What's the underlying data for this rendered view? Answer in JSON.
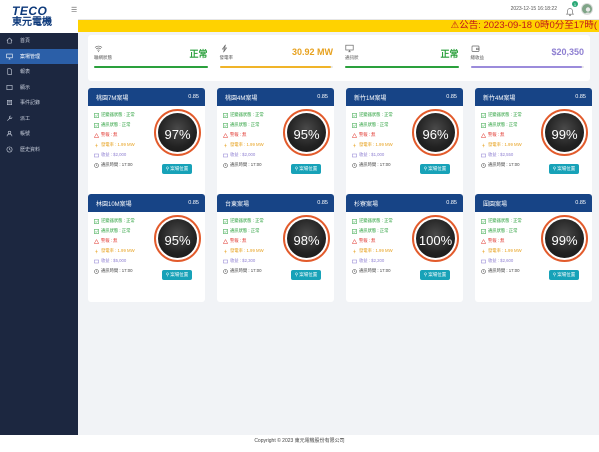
{
  "brand": {
    "line1": "TECO",
    "line2": "東元電機"
  },
  "nav": [
    {
      "label": "首頁",
      "icon": "home-icon"
    },
    {
      "label": "案場管理",
      "icon": "monitor-icon",
      "active": true
    },
    {
      "label": "報表",
      "icon": "document-icon"
    },
    {
      "label": "顯示",
      "icon": "display-icon"
    },
    {
      "label": "事件記錄",
      "icon": "log-icon"
    },
    {
      "label": "派工",
      "icon": "wrench-icon"
    },
    {
      "label": "帳號",
      "icon": "user-icon"
    },
    {
      "label": "歷史資料",
      "icon": "history-icon"
    }
  ],
  "header": {
    "datetime": "2023-12-15 16:18:22",
    "notification_count": "1"
  },
  "marquee": "⚠公告: 2023-09-18 0時0分至17時(",
  "summary": [
    {
      "label": "聯網狀態",
      "value": "正常",
      "color": "#2aa03c",
      "bar_color": "#2aa03c",
      "bar_fill": 1.0,
      "icon": "wifi-icon"
    },
    {
      "label": "發電率",
      "value": "30.92 MW",
      "color": "#e7a11e",
      "bar_color": "#f0b429",
      "bar_fill": 0.98,
      "icon": "bolt-icon"
    },
    {
      "label": "通訊狀",
      "value": "正常",
      "color": "#2aa03c",
      "bar_color": "#2aa03c",
      "bar_fill": 1.0,
      "icon": "monitor-icon"
    },
    {
      "label": "總收益",
      "value": "$20,350",
      "color": "#8e7fd1",
      "bar_color": "#9b8bdb",
      "bar_fill": 0.98,
      "icon": "wallet-icon"
    }
  ],
  "sites": [
    {
      "name": "桃園7M案場",
      "efficiency": "0.85",
      "percent": "97%",
      "inverter": "逆變器狀態 : 正常",
      "comm": "通訊狀態 : 正常",
      "alert": "警報 : 無",
      "power": "發電率 : 1.99 MW",
      "revenue": "收益 : $2,000",
      "time": "通訊時間 : 17:00",
      "button": "案場位置"
    },
    {
      "name": "桃園4M案場",
      "efficiency": "0.85",
      "percent": "95%",
      "inverter": "逆變器狀態 : 正常",
      "comm": "通訊狀態 : 正常",
      "alert": "警報 : 無",
      "power": "發電率 : 1.99 MW",
      "revenue": "收益 : $2,000",
      "time": "通訊時間 : 17:00",
      "button": "案場位置"
    },
    {
      "name": "新竹1M案場",
      "efficiency": "0.85",
      "percent": "96%",
      "inverter": "逆變器狀態 : 正常",
      "comm": "通訊狀態 : 正常",
      "alert": "警報 : 無",
      "power": "發電率 : 1.99 MW",
      "revenue": "收益 : $1,000",
      "time": "通訊時間 : 17:00",
      "button": "案場位置"
    },
    {
      "name": "新竹4M案場",
      "efficiency": "0.85",
      "percent": "99%",
      "inverter": "逆變器狀態 : 正常",
      "comm": "通訊狀態 : 正常",
      "alert": "警報 : 無",
      "power": "發電率 : 1.99 MW",
      "revenue": "收益 : $2,550",
      "time": "通訊時間 : 17:00",
      "button": "案場位置"
    },
    {
      "name": "林園10M案場",
      "efficiency": "0.85",
      "percent": "95%",
      "inverter": "逆變器狀態 : 正常",
      "comm": "通訊狀態 : 正常",
      "alert": "警報 : 無",
      "power": "發電率 : 1.99 MW",
      "revenue": "收益 : $5,000",
      "time": "通訊時間 : 17:00",
      "button": "案場位置"
    },
    {
      "name": "台東案場",
      "efficiency": "0.85",
      "percent": "98%",
      "inverter": "逆變器狀態 : 正常",
      "comm": "通訊狀態 : 正常",
      "alert": "警報 : 無",
      "power": "發電率 : 1.99 MW",
      "revenue": "收益 : $2,300",
      "time": "通訊時間 : 17:00",
      "button": "案場位置"
    },
    {
      "name": "杉寮案場",
      "efficiency": "0.85",
      "percent": "100%",
      "inverter": "逆變器狀態 : 正常",
      "comm": "通訊狀態 : 正常",
      "alert": "警報 : 無",
      "power": "發電率 : 1.99 MW",
      "revenue": "收益 : $2,200",
      "time": "通訊時間 : 17:00",
      "button": "案場位置"
    },
    {
      "name": "圍園案場",
      "efficiency": "0.85",
      "percent": "99%",
      "inverter": "逆變器狀態 : 正常",
      "comm": "通訊狀態 : 正常",
      "alert": "警報 : 無",
      "power": "發電率 : 1.99 MW",
      "revenue": "收益 : $2,600",
      "time": "通訊時間 : 17:00",
      "button": "案場位置"
    }
  ],
  "footer": "Copyright © 2023 東元電機股份有限公司"
}
